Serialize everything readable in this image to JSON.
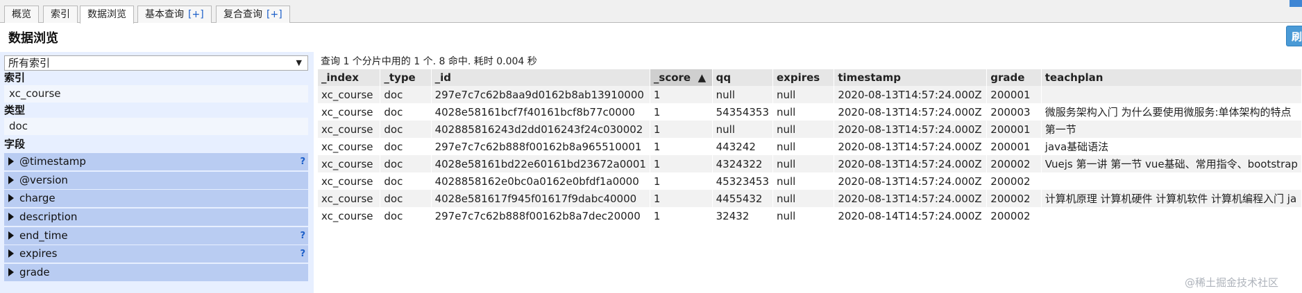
{
  "tabs": [
    {
      "label": "概览",
      "plus": ""
    },
    {
      "label": "索引",
      "plus": ""
    },
    {
      "label": "数据浏览",
      "plus": ""
    },
    {
      "label": "基本查询",
      "plus": "[+]"
    },
    {
      "label": "复合查询",
      "plus": "[+]"
    }
  ],
  "header": {
    "title": "数据浏览",
    "refresh_label": "刷"
  },
  "sidebar": {
    "index_select": "所有索引",
    "index_heading": "索引",
    "index_value": "xc_course",
    "type_heading": "类型",
    "type_value": "doc",
    "fields_heading": "字段",
    "fields": [
      {
        "name": "@timestamp",
        "help": "?"
      },
      {
        "name": "@version",
        "help": ""
      },
      {
        "name": "charge",
        "help": ""
      },
      {
        "name": "description",
        "help": ""
      },
      {
        "name": "end_time",
        "help": "?"
      },
      {
        "name": "expires",
        "help": "?"
      },
      {
        "name": "grade",
        "help": ""
      }
    ]
  },
  "results": {
    "summary": "查询 1 个分片中用的 1 个. 8 命中. 耗时 0.004 秒",
    "sort_indicator": "▲",
    "columns": [
      "_index",
      "_type",
      "_id",
      "_score",
      "qq",
      "expires",
      "timestamp",
      "grade",
      "teachplan"
    ],
    "rows": [
      [
        "xc_course",
        "doc",
        "297e7c7c62b8aa9d0162b8ab13910000",
        "1",
        "null",
        "null",
        "2020-08-13T14:57:24.000Z",
        "200001",
        ""
      ],
      [
        "xc_course",
        "doc",
        "4028e58161bcf7f40161bcf8b77c0000",
        "1",
        "54354353",
        "null",
        "2020-08-13T14:57:24.000Z",
        "200003",
        "微服务架构入门 为什么要使用微服务:单体架构的特点"
      ],
      [
        "xc_course",
        "doc",
        "402885816243d2dd016243f24c030002",
        "1",
        "null",
        "null",
        "2020-08-13T14:57:24.000Z",
        "200001",
        "第一节"
      ],
      [
        "xc_course",
        "doc",
        "297e7c7c62b888f00162b8a965510001",
        "1",
        "443242",
        "null",
        "2020-08-13T14:57:24.000Z",
        "200001",
        "java基础语法"
      ],
      [
        "xc_course",
        "doc",
        "4028e58161bd22e60161bd23672a0001",
        "1",
        "4324322",
        "null",
        "2020-08-13T14:57:24.000Z",
        "200002",
        "Vuejs 第一讲 第一节 vue基础、常用指令、bootstrap"
      ],
      [
        "xc_course",
        "doc",
        "4028858162e0bc0a0162e0bfdf1a0000",
        "1",
        "45323453",
        "null",
        "2020-08-13T14:57:24.000Z",
        "200002",
        ""
      ],
      [
        "xc_course",
        "doc",
        "4028e581617f945f01617f9dabc40000",
        "1",
        "4455432",
        "null",
        "2020-08-13T14:57:24.000Z",
        "200002",
        "计算机原理 计算机硬件 计算机软件 计算机编程入门 ja"
      ],
      [
        "xc_course",
        "doc",
        "297e7c7c62b888f00162b8a7dec20000",
        "1",
        "32432",
        "null",
        "2020-08-14T14:57:24.000Z",
        "200002",
        ""
      ]
    ]
  },
  "watermark": "@稀土掘金技术社区"
}
